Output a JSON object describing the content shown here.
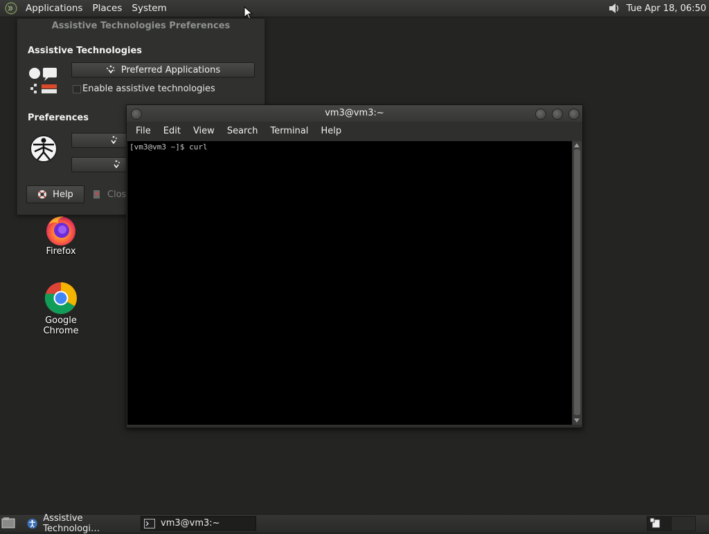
{
  "top_panel": {
    "menus": [
      "Applications",
      "Places",
      "System"
    ],
    "clock": "Tue Apr 18, 06:50"
  },
  "at_dialog": {
    "title": "Assistive Technologies Preferences",
    "section_assistive": "Assistive Technologies",
    "preferred_apps_label": "Preferred Applications",
    "enable_label": "Enable assistive technologies",
    "section_preferences": "Preferences",
    "help_label": "Help",
    "close_label": "Clos"
  },
  "desktop_icons": [
    {
      "label": "Firefox",
      "icon": "firefox-icon"
    },
    {
      "label": "Google Chrome",
      "icon": "chrome-icon"
    }
  ],
  "terminal": {
    "title": "vm3@vm3:~",
    "menus": [
      "File",
      "Edit",
      "View",
      "Search",
      "Terminal",
      "Help"
    ],
    "content": "[vm3@vm3 ~]$ curl"
  },
  "taskbar": {
    "items": [
      {
        "label": "Assistive Technologi…",
        "icon": "accessibility-icon",
        "active": false
      },
      {
        "label": "vm3@vm3:~",
        "icon": "terminal-icon",
        "active": true
      }
    ]
  },
  "colors": {
    "desktop": "#242523",
    "panel": "#30312f",
    "terminal_bg": "#000000"
  }
}
